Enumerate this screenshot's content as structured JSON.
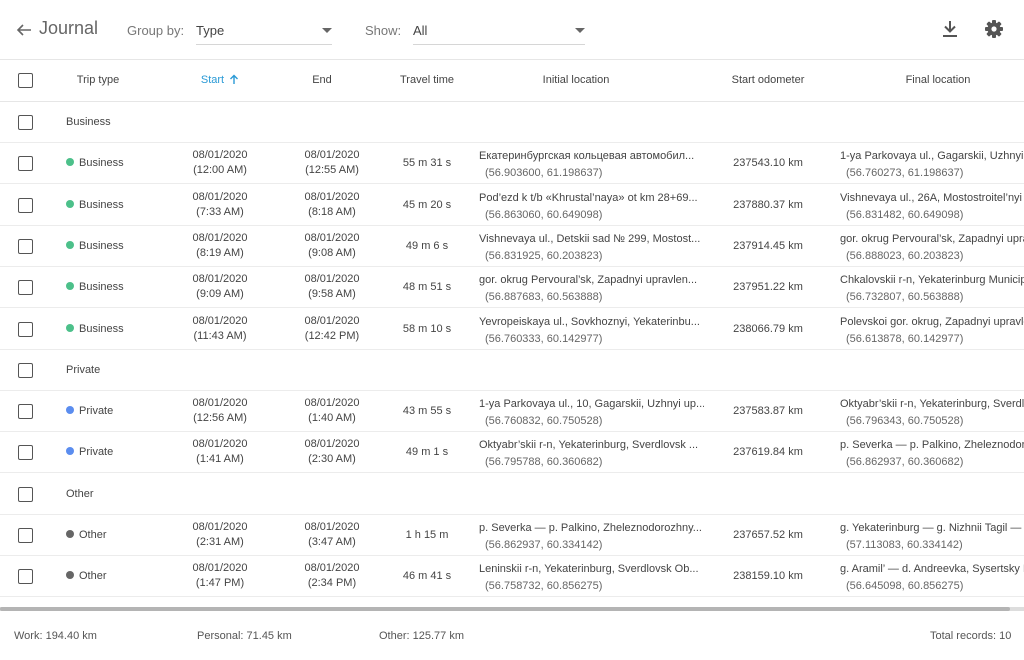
{
  "header": {
    "title": "Journal",
    "group_by_label": "Group by:",
    "group_by_value": "Type",
    "show_label": "Show:",
    "show_value": "All"
  },
  "columns": {
    "trip_type": "Trip type",
    "start": "Start",
    "end": "End",
    "travel_time": "Travel time",
    "initial_location": "Initial location",
    "start_odometer": "Start odometer",
    "final_location": "Final location"
  },
  "colors": {
    "business": "#4cc08a",
    "private": "#5b8def",
    "other": "#666666",
    "accent": "#2a9ad6"
  },
  "groups": [
    {
      "label": "Business",
      "trips": [
        {
          "type": "Business",
          "start_date": "08/01/2020",
          "start_time": "(12:00 AM)",
          "end_date": "08/01/2020",
          "end_time": "(12:55 AM)",
          "travel": "55 m 31 s",
          "init_addr": "Екатеринбургская кольцевая автомобил...",
          "init_coord": "(56.903600, 61.198637)",
          "odometer": "237543.10 km",
          "final_addr": "1-ya Parkovaya ul., Gagarskii, Uzhnyi u",
          "final_coord": "(56.760273, 61.198637)"
        },
        {
          "type": "Business",
          "start_date": "08/01/2020",
          "start_time": "(7:33 AM)",
          "end_date": "08/01/2020",
          "end_time": "(8:18 AM)",
          "travel": "45 m 20 s",
          "init_addr": "Pod’ezd k t/b «Khrustal’naya» ot km 28+69...",
          "init_coord": "(56.863060, 60.649098)",
          "odometer": "237880.37 km",
          "final_addr": "Vishnevaya ul., 26A, Mostostroitel’nyi c",
          "final_coord": "(56.831482, 60.649098)"
        },
        {
          "type": "Business",
          "start_date": "08/01/2020",
          "start_time": "(8:19 AM)",
          "end_date": "08/01/2020",
          "end_time": "(9:08 AM)",
          "travel": "49 m 6 s",
          "init_addr": "Vishnevaya ul., Detskii sad № 299, Mostost...",
          "init_coord": "(56.831925, 60.203823)",
          "odometer": "237914.45 km",
          "final_addr": "gor. okrug Pervoural’sk, Zapadnyi upra",
          "final_coord": "(56.888023, 60.203823)"
        },
        {
          "type": "Business",
          "start_date": "08/01/2020",
          "start_time": "(9:09 AM)",
          "end_date": "08/01/2020",
          "end_time": "(9:58 AM)",
          "travel": "48 m 51 s",
          "init_addr": "gor. okrug Pervoural’sk, Zapadnyi upravlen...",
          "init_coord": "(56.887683, 60.563888)",
          "odometer": "237951.22 km",
          "final_addr": "Chkalovskii r-n, Yekaterinburg Municip",
          "final_coord": "(56.732807, 60.563888)"
        },
        {
          "type": "Business",
          "start_date": "08/01/2020",
          "start_time": "(11:43 AM)",
          "end_date": "08/01/2020",
          "end_time": "(12:42 PM)",
          "travel": "58 m 10 s",
          "init_addr": "Yevropeiskaya ul., Sovkhoznyi, Yekaterinbu...",
          "init_coord": "(56.760333, 60.142977)",
          "odometer": "238066.79 km",
          "final_addr": "Polevskoi gor. okrug, Zapadnyi upravle",
          "final_coord": "(56.613878, 60.142977)"
        }
      ]
    },
    {
      "label": "Private",
      "trips": [
        {
          "type": "Private",
          "start_date": "08/01/2020",
          "start_time": "(12:56 AM)",
          "end_date": "08/01/2020",
          "end_time": "(1:40 AM)",
          "travel": "43 m 55 s",
          "init_addr": "1-ya Parkovaya ul., 10, Gagarskii, Uzhnyi up...",
          "init_coord": "(56.760832, 60.750528)",
          "odometer": "237583.87 km",
          "final_addr": "Oktyabr’skii r-n, Yekaterinburg, Sverdlo",
          "final_coord": "(56.796343, 60.750528)"
        },
        {
          "type": "Private",
          "start_date": "08/01/2020",
          "start_time": "(1:41 AM)",
          "end_date": "08/01/2020",
          "end_time": "(2:30 AM)",
          "travel": "49 m 1 s",
          "init_addr": "Oktyabr’skii r-n, Yekaterinburg, Sverdlovsk ...",
          "init_coord": "(56.795788, 60.360682)",
          "odometer": "237619.84 km",
          "final_addr": "p. Severka — p. Palkino, Zheleznodoro",
          "final_coord": "(56.862937, 60.360682)"
        }
      ]
    },
    {
      "label": "Other",
      "trips": [
        {
          "type": "Other",
          "start_date": "08/01/2020",
          "start_time": "(2:31 AM)",
          "end_date": "08/01/2020",
          "end_time": "(3:47 AM)",
          "travel": "1 h 15 m",
          "init_addr": "p. Severka — p. Palkino, Zheleznodorozhny...",
          "init_coord": "(56.862937, 60.334142)",
          "odometer": "237657.52 km",
          "final_addr": "g. Yekaterinburg — g. Nizhnii Tagil — g",
          "final_coord": "(57.113083, 60.334142)"
        },
        {
          "type": "Other",
          "start_date": "08/01/2020",
          "start_time": "(1:47 PM)",
          "end_date": "08/01/2020",
          "end_time": "(2:34 PM)",
          "travel": "46 m 41 s",
          "init_addr": "Leninskii r-n, Yekaterinburg, Sverdlovsk Ob...",
          "init_coord": "(56.758732, 60.856275)",
          "odometer": "238159.10 km",
          "final_addr": "g. Aramil’ — d. Andreevka, Sysertsky D",
          "final_coord": "(56.645098, 60.856275)"
        }
      ]
    }
  ],
  "footer": {
    "work": "Work: 194.40 km",
    "personal": "Personal: 71.45 km",
    "other": "Other: 125.77 km",
    "total": "Total records: 10"
  }
}
